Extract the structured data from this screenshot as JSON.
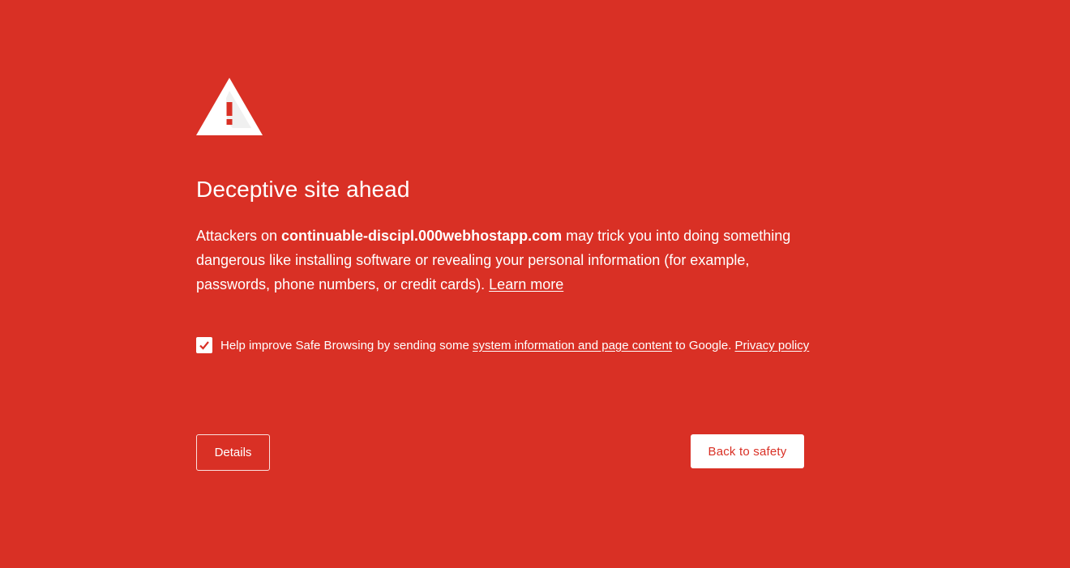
{
  "interstitial": {
    "title": "Deceptive site ahead",
    "message": {
      "prefix": "Attackers on ",
      "site": "continuable-discipl.000webhostapp.com",
      "suffix": " may trick you into doing something dangerous like installing software or revealing your personal information (for example, passwords, phone numbers, or credit cards). ",
      "learn_more": "Learn more"
    },
    "optin": {
      "checked": true,
      "prefix": "Help improve Safe Browsing by sending some ",
      "link": "system information and page content",
      "suffix": " to Google. ",
      "privacy_link": "Privacy policy"
    },
    "buttons": {
      "details": "Details",
      "back_to_safety": "Back to safety"
    },
    "colors": {
      "background": "#d93025",
      "text": "#ffffff"
    },
    "icons": {
      "warning": "warning-triangle-icon",
      "checkbox": "checkmark-icon"
    }
  }
}
